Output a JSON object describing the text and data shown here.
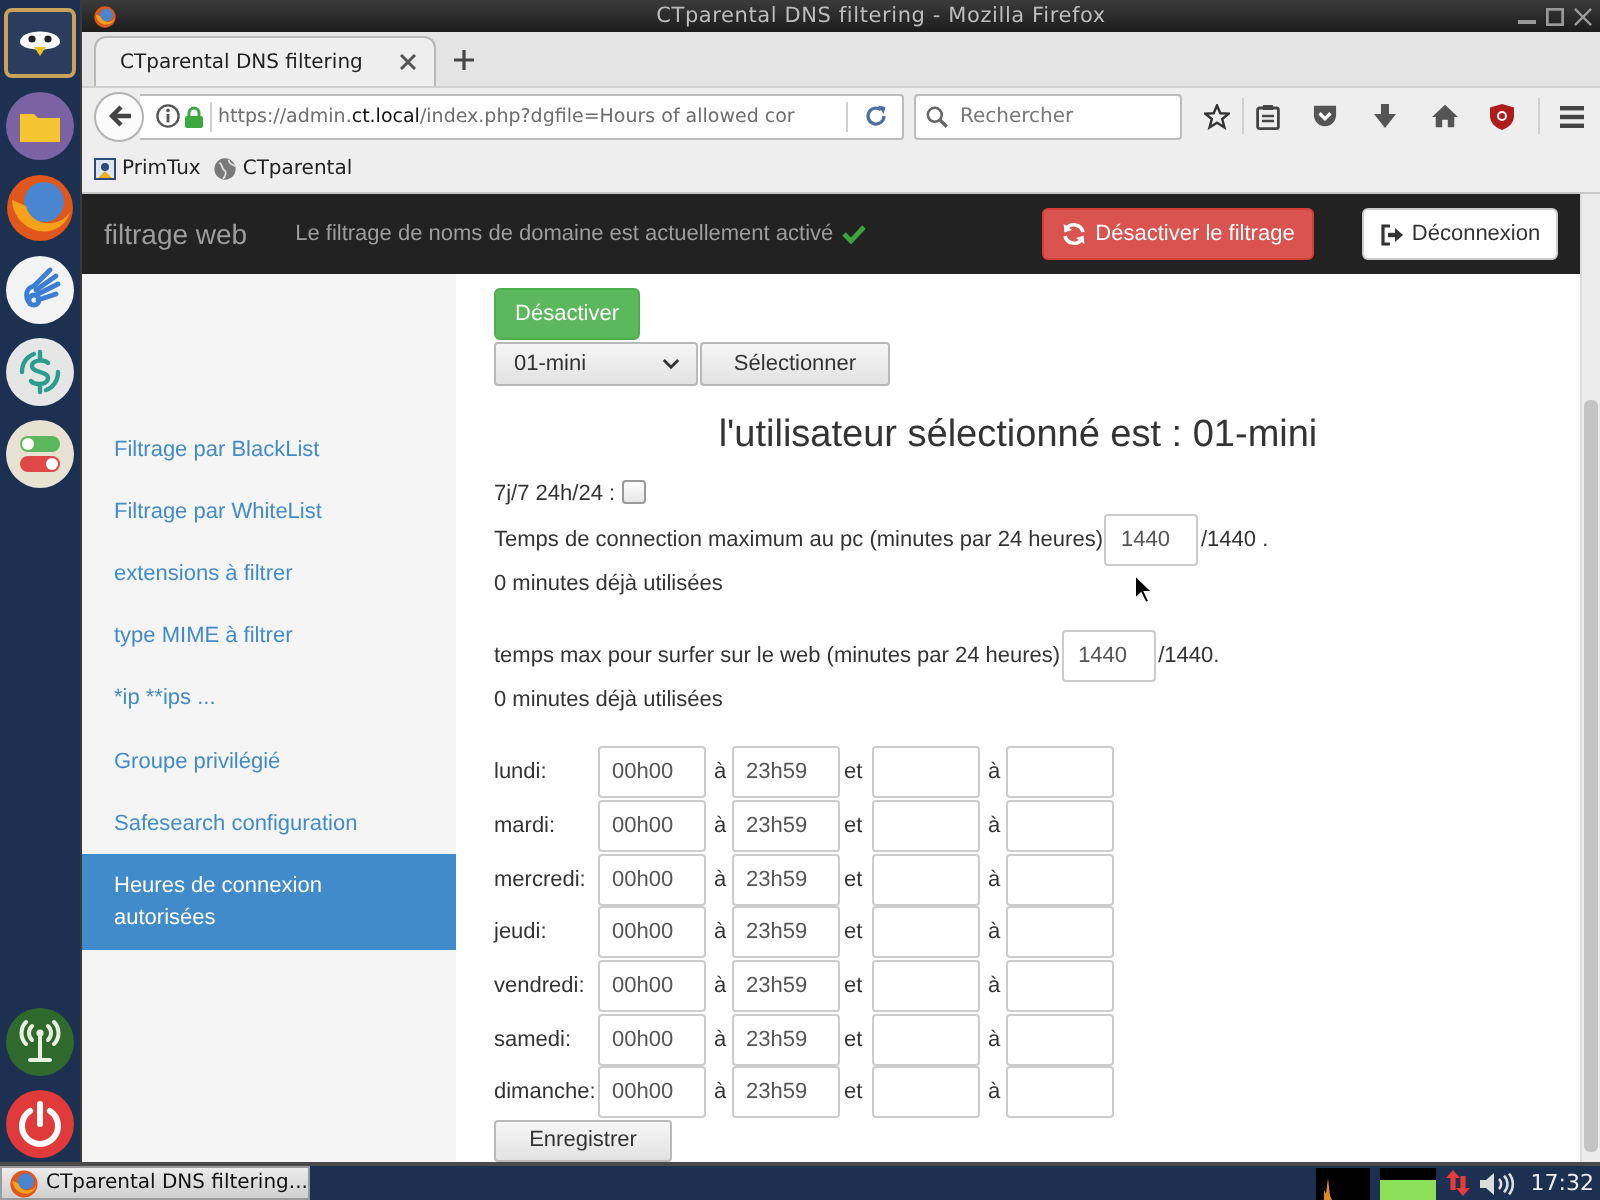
{
  "window": {
    "title": "CTparental DNS filtering - Mozilla Firefox"
  },
  "tabs": [
    {
      "label": "CTparental DNS filtering",
      "selected": true
    }
  ],
  "address_bar": {
    "url_start": "https://admin.",
    "url_domain": "ct.local",
    "url_end": "/index.php?dgfile=Hours of allowed cor"
  },
  "search": {
    "placeholder": "Rechercher"
  },
  "bookmarks": [
    {
      "label": "PrimTux",
      "kind": "app"
    },
    {
      "label": "CTparental",
      "kind": "site"
    }
  ],
  "page_header": {
    "brand": "filtrage web",
    "status": "Le filtrage de noms de domaine est actuellement activé",
    "toggle_button": "Désactiver le filtrage",
    "logout_button": "Déconnexion"
  },
  "sidebar": {
    "items": [
      {
        "label": "Filtrage par BlackList",
        "selected": false
      },
      {
        "label": "Filtrage par WhiteList",
        "selected": false
      },
      {
        "label": "extensions à filtrer",
        "selected": false
      },
      {
        "label": "type MIME à filtrer",
        "selected": false
      },
      {
        "label": "*ip **ips ...",
        "selected": false
      },
      {
        "label": "Groupe privilégié",
        "selected": false
      },
      {
        "label": "Safesearch configuration",
        "selected": false
      },
      {
        "label": "Heures de connexion autorisées",
        "selected": true
      }
    ]
  },
  "content": {
    "disable_button": "Désactiver",
    "user_select": {
      "value": "01-mini"
    },
    "select_button": "Sélectionner",
    "heading": "l'utilisateur sélectionné est : 01-mini",
    "always_allowed": {
      "label": "7j/7 24h/24 :",
      "checked": false
    },
    "limits": [
      {
        "label": "Temps de connection maximum au pc (minutes par 24 heures)",
        "value": "1440",
        "suffix": "/1440 .",
        "used": "0 minutes déjà utilisées"
      },
      {
        "label": "temps max pour surfer sur le web (minutes par 24 heures)",
        "value": "1440",
        "suffix": "/1440.",
        "used": "0 minutes déjà utilisées"
      }
    ],
    "schedule": [
      {
        "day": "lundi:",
        "from": "00h00",
        "word_to": "à",
        "to": "23h59",
        "word_and": "et",
        "word_to_2": "à"
      },
      {
        "day": "mardi:",
        "from": "00h00",
        "word_to": "à",
        "to": "23h59",
        "word_and": "et",
        "word_to_2": "à"
      },
      {
        "day": "mercredi:",
        "from": "00h00",
        "word_to": "à",
        "to": "23h59",
        "word_and": "et",
        "word_to_2": "à"
      },
      {
        "day": "jeudi:",
        "from": "00h00",
        "word_to": "à",
        "to": "23h59",
        "word_and": "et",
        "word_to_2": "à"
      },
      {
        "day": "vendredi:",
        "from": "00h00",
        "word_to": "à",
        "to": "23h59",
        "word_and": "et",
        "word_to_2": "à"
      },
      {
        "day": "samedi:",
        "from": "00h00",
        "word_to": "à",
        "to": "23h59",
        "word_and": "et",
        "word_to_2": "à"
      },
      {
        "day": "dimanche:",
        "from": "00h00",
        "word_to": "à",
        "to": "23h59",
        "word_and": "et",
        "word_to_2": "à"
      }
    ],
    "save_button": "Enregistrer"
  },
  "taskbar": {
    "window_button": "CTparental DNS filtering...",
    "clock": "17:32"
  }
}
